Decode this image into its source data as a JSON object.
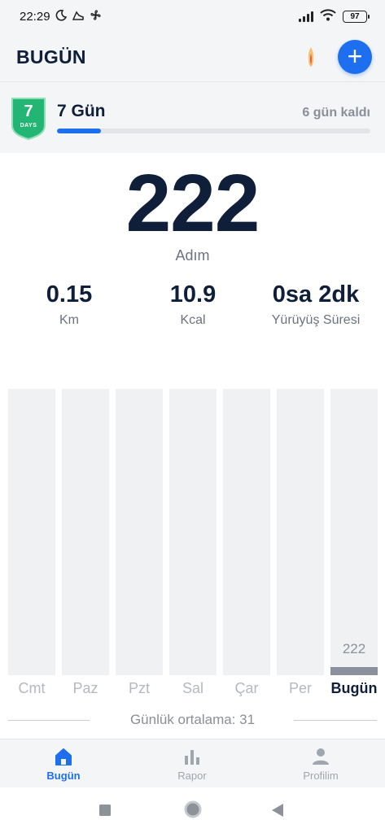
{
  "status_bar": {
    "time": "22:29",
    "battery": "97",
    "icons": [
      "moon-icon",
      "shoe-icon",
      "fan-icon",
      "signal-icon",
      "wifi-icon",
      "battery-icon"
    ]
  },
  "header": {
    "title": "BUGÜN",
    "add_icon": "plus-icon",
    "streak_icon": "flame-icon",
    "accent_color": "#1e6ff0"
  },
  "challenge": {
    "badge_number": "7",
    "badge_text": "DAYS",
    "title": "7 Gün",
    "remaining": "6 gün kaldı",
    "progress": 0.14,
    "badge_color": "#22b574"
  },
  "today": {
    "steps": "222",
    "steps_label": "Adım",
    "stats": [
      {
        "value": "0.15",
        "label": "Km"
      },
      {
        "value": "10.9",
        "label": "Kcal"
      },
      {
        "value": "0sa 2dk",
        "label": "Yürüyüş Süresi"
      }
    ]
  },
  "chart_data": {
    "type": "bar",
    "categories": [
      "Cmt",
      "Paz",
      "Pzt",
      "Sal",
      "Çar",
      "Per",
      "Bugün"
    ],
    "values": [
      0,
      0,
      0,
      0,
      0,
      0,
      222
    ],
    "value_labels": [
      "",
      "",
      "",
      "",
      "",
      "",
      "222"
    ],
    "highlight_index": 6,
    "ylim": [
      0,
      8000
    ],
    "grid": false
  },
  "average": {
    "text": "Günlük ortalama: 31"
  },
  "bottom_nav": {
    "items": [
      {
        "label": "Bugün",
        "icon": "home-icon",
        "active": true
      },
      {
        "label": "Rapor",
        "icon": "bar-chart-icon",
        "active": false
      },
      {
        "label": "Profilim",
        "icon": "profile-icon",
        "active": false
      }
    ]
  },
  "system_nav": {
    "icons": [
      "recents-square-icon",
      "home-circle-icon",
      "back-triangle-icon"
    ]
  }
}
